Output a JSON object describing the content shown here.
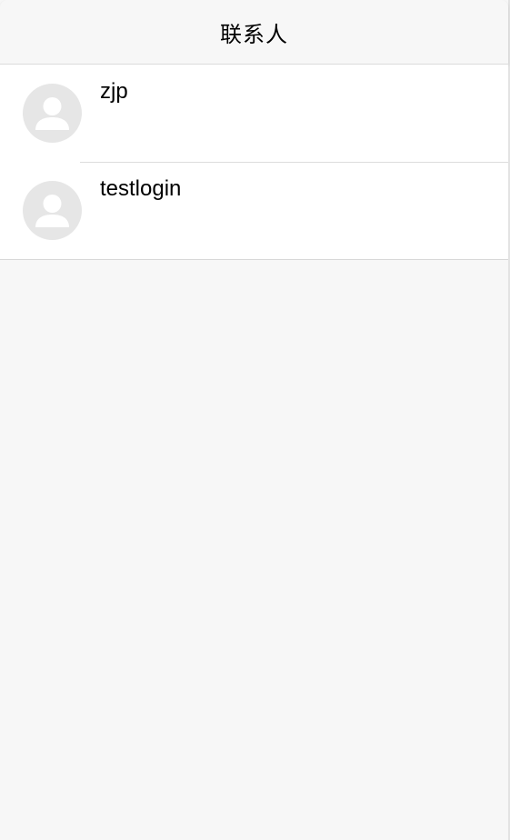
{
  "navbar": {
    "title": "联系人"
  },
  "contacts": [
    {
      "name": "zjp",
      "avatar_icon": "person-placeholder-icon"
    },
    {
      "name": "testlogin",
      "avatar_icon": "person-placeholder-icon"
    }
  ],
  "colors": {
    "background": "#f7f7f7",
    "list_background": "#ffffff",
    "avatar_background": "#e6e6e6",
    "avatar_glyph": "#ffffff",
    "divider": "#dcdcdc"
  }
}
